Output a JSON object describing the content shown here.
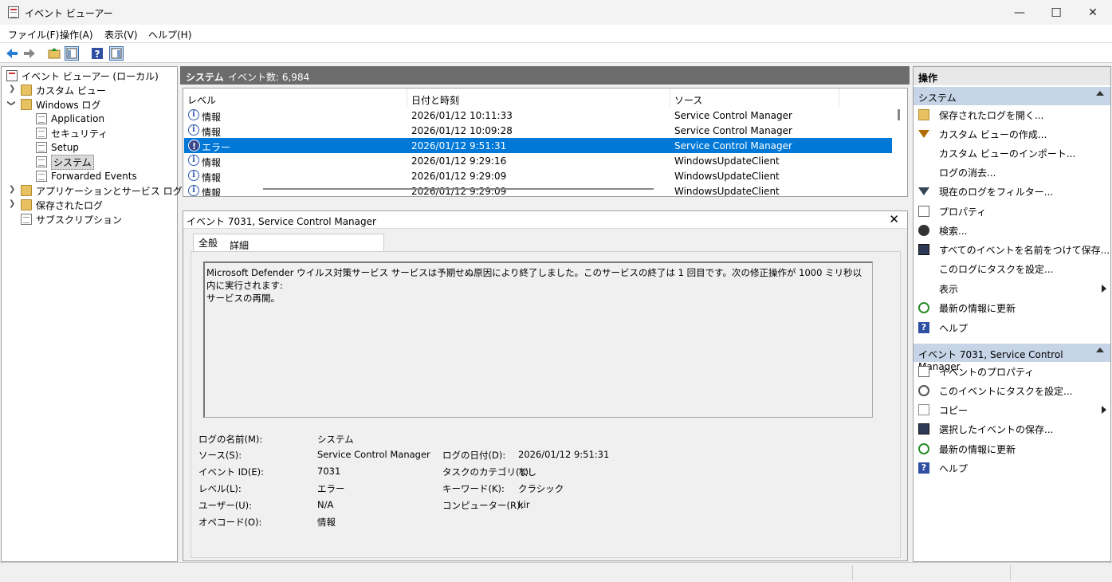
{
  "window": {
    "title": "イベント ビューアー",
    "min": "—",
    "max": "☐",
    "close": "✕"
  },
  "menu": [
    "ファイル(F)",
    "操作(A)",
    "表示(V)",
    "ヘルプ(H)"
  ],
  "tree": {
    "root": "イベント ビューアー (ローカル)",
    "custom_views": "カスタム ビュー",
    "windows_logs": "Windows ログ",
    "application": "Application",
    "security": "セキュリティ",
    "setup": "Setup",
    "system": "システム",
    "forwarded": "Forwarded Events",
    "app_service": "アプリケーションとサービス ログ",
    "saved": "保存されたログ",
    "subscriptions": "サブスクリプション"
  },
  "log_header": {
    "name": "システム",
    "count": "イベント数: 6,984"
  },
  "columns": [
    "レベル",
    "日付と時刻",
    "ソース"
  ],
  "events": [
    {
      "level": "情報",
      "datetime": "2026/01/12 10:11:33",
      "source": "Service Control Manager",
      "type": "info"
    },
    {
      "level": "情報",
      "datetime": "2026/01/12 10:09:28",
      "source": "Service Control Manager",
      "type": "info"
    },
    {
      "level": "エラー",
      "datetime": "2026/01/12 9:51:31",
      "source": "Service Control Manager",
      "type": "error"
    },
    {
      "level": "情報",
      "datetime": "2026/01/12 9:29:16",
      "source": "WindowsUpdateClient",
      "type": "info"
    },
    {
      "level": "情報",
      "datetime": "2026/01/12 9:29:09",
      "source": "WindowsUpdateClient",
      "type": "info"
    },
    {
      "level": "情報",
      "datetime": "2026/01/12 9:29:09",
      "source": "WindowsUpdateClient",
      "type": "info"
    }
  ],
  "detail": {
    "title": "イベント 7031, Service Control Manager",
    "tab_general": "全般",
    "tab_details": "詳細",
    "message_line1": "Microsoft Defender ウイルス対策サービス サービスは予期せぬ原因により終了しました。このサービスの終了は 1 回目です。次の修正操作が 1000 ミリ秒以内に実行されます:",
    "message_line2": "サービスの再開。",
    "labels": {
      "log_name": "ログの名前(M):",
      "source": "ソース(S):",
      "event_id": "イベント ID(E):",
      "level": "レベル(L):",
      "user": "ユーザー(U):",
      "opcode": "オペコード(O):",
      "logged": "ログの日付(D):",
      "task_category": "タスクのカテゴリ(Y):",
      "keywords": "キーワード(K):",
      "computer": "コンピューター(R):"
    },
    "values": {
      "log_name": "システム",
      "source": "Service Control Manager",
      "event_id": "7031",
      "level": "エラー",
      "user": "N/A",
      "opcode": "情報",
      "logged": "2026/01/12 9:51:31",
      "task_category": "なし",
      "keywords": "クラシック",
      "computer": "kir"
    }
  },
  "actions": {
    "title": "操作",
    "section1": "システム",
    "items1": [
      "保存されたログを開く...",
      "カスタム ビューの作成...",
      "カスタム ビューのインポート...",
      "ログの消去...",
      "現在のログをフィルター...",
      "プロパティ",
      "検索...",
      "すべてのイベントを名前をつけて保存...",
      "このログにタスクを設定...",
      "表示",
      "最新の情報に更新",
      "ヘルプ"
    ],
    "section2": "イベント 7031, Service Control Manager",
    "items2": [
      "イベントのプロパティ",
      "このイベントにタスクを設定...",
      "コピー",
      "選択したイベントの保存...",
      "最新の情報に更新",
      "ヘルプ"
    ]
  }
}
